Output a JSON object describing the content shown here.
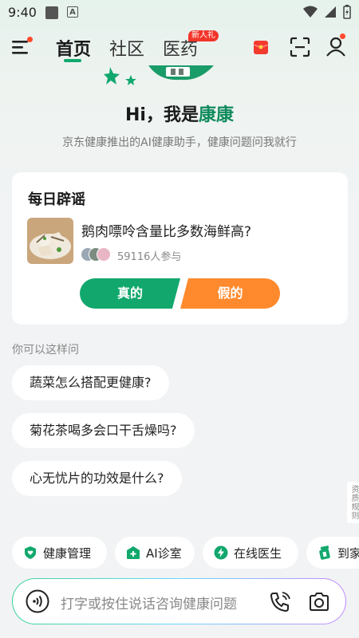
{
  "status_bar": {
    "time": "9:40",
    "a_icon": "A"
  },
  "nav": {
    "tabs": [
      {
        "label": "首页",
        "active": true
      },
      {
        "label": "社区",
        "active": false
      },
      {
        "label": "医药",
        "active": false
      }
    ],
    "badge": "新人礼",
    "accent_color": "#12a86d"
  },
  "hero": {
    "greeting": "Hi，我是",
    "name": "康康",
    "subtitle": "京东健康推出的AI健康助手，健康问题问我就行"
  },
  "rumor_card": {
    "title": "每日辟谣",
    "question": "鹅肉嘌呤含量比多数海鲜高?",
    "participants": "59116人参与",
    "true_label": "真的",
    "false_label": "假的"
  },
  "suggestions": {
    "label": "你可以这样问",
    "items": [
      "蔬菜怎么搭配更健康?",
      "菊花茶喝多会口干舌燥吗?",
      "心无忧片的功效是什么?"
    ]
  },
  "side_tag": "资质规则",
  "quick_actions": [
    {
      "label": "健康管理",
      "icon": "shield-heart-icon"
    },
    {
      "label": "AI诊室",
      "icon": "hospital-plus-icon"
    },
    {
      "label": "在线医生",
      "icon": "lightning-icon"
    },
    {
      "label": "到家",
      "icon": "medicine-bottle-icon"
    }
  ],
  "input_bar": {
    "placeholder": "打字或按住说话咨询健康问题"
  }
}
